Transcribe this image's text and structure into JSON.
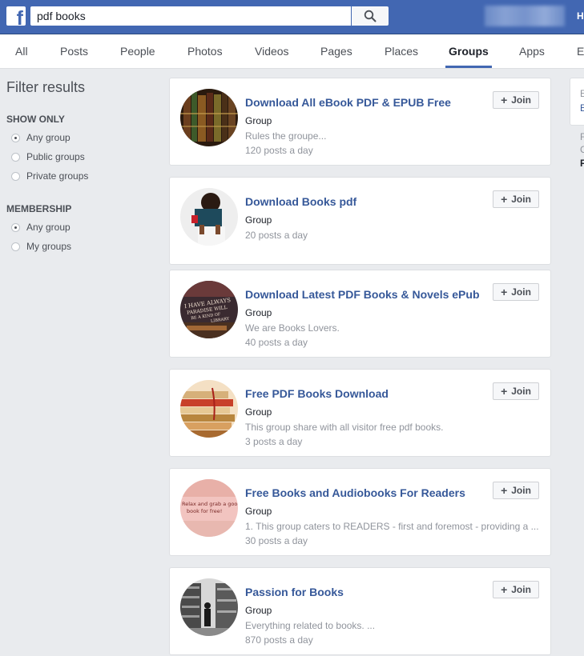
{
  "header": {
    "logo_letter": "f",
    "search_value": "pdf books",
    "search_placeholder": "Search",
    "right_initial": "H",
    "colors": {
      "brand": "#4267b2",
      "link": "#365899"
    }
  },
  "tabs": [
    {
      "label": "All"
    },
    {
      "label": "Posts"
    },
    {
      "label": "People"
    },
    {
      "label": "Photos"
    },
    {
      "label": "Videos"
    },
    {
      "label": "Pages"
    },
    {
      "label": "Places"
    },
    {
      "label": "Groups",
      "active": true
    },
    {
      "label": "Apps"
    },
    {
      "label": "E"
    }
  ],
  "filters": {
    "title": "Filter results",
    "show_only": {
      "heading": "SHOW ONLY",
      "options": [
        {
          "label": "Any group",
          "selected": true
        },
        {
          "label": "Public groups",
          "selected": false
        },
        {
          "label": "Private groups",
          "selected": false
        }
      ]
    },
    "membership": {
      "heading": "MEMBERSHIP",
      "options": [
        {
          "label": "Any group",
          "selected": true
        },
        {
          "label": "My groups",
          "selected": false
        }
      ]
    }
  },
  "results": [
    {
      "title": "Download All eBook PDF & EPUB Free",
      "type": "Group",
      "desc": "Rules the groupe...",
      "posts": "120 posts a day",
      "join": "Join"
    },
    {
      "title": "Download Books pdf",
      "type": "Group",
      "desc": "",
      "posts": "20 posts a day",
      "join": "Join"
    },
    {
      "title": "Download Latest PDF Books & Novels ePub",
      "type": "Group",
      "desc": "We are Books Lovers.",
      "posts": "40 posts a day",
      "join": "Join"
    },
    {
      "title": "Free PDF Books Download",
      "type": "Group",
      "desc": "This group share with all visitor free pdf books.",
      "posts": "3 posts a day",
      "join": "Join"
    },
    {
      "title": "Free Books and Audiobooks For Readers",
      "type": "Group",
      "desc": "1. This group caters to READERS - first and foremost - providing a ...",
      "posts": "30 posts a day",
      "join": "Join"
    },
    {
      "title": "Passion for Books",
      "type": "Group",
      "desc": "Everything related to books. ...",
      "posts": "870 posts a day",
      "join": "Join"
    }
  ],
  "thumb_text": {
    "r3": [
      "I HAVE ALWAYS",
      "PARADISE WILL",
      "BE A KIND OF",
      "LIBRARY"
    ],
    "r5": [
      "Relax and grab a good",
      "book for free!"
    ]
  },
  "right_column": {
    "box_chars": [
      "E",
      "E"
    ],
    "text_chars": [
      "F",
      "C",
      "F"
    ]
  }
}
